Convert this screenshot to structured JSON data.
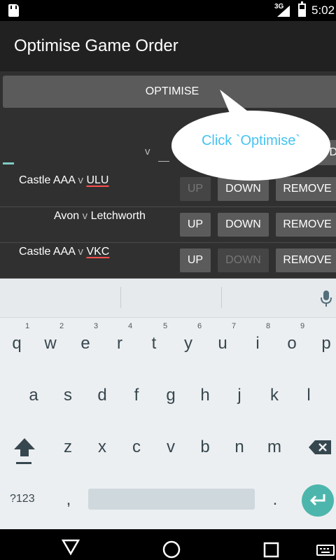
{
  "status_bar": {
    "network_label": "3G",
    "time": "5:02",
    "icons": [
      "sd-card-icon",
      "signal-icon",
      "battery-icon"
    ]
  },
  "app_bar": {
    "title": "Optimise Game Order"
  },
  "optimise_button": {
    "label": "OPTIMISE"
  },
  "input_row": {
    "separator": "v",
    "add_button_partial": "D"
  },
  "games": [
    {
      "home": "Castle AAA",
      "sep": "v",
      "away": "ULU",
      "up": "UP",
      "down": "DOWN",
      "remove": "REMOVE",
      "up_enabled": false,
      "down_enabled": true
    },
    {
      "home": "Avon",
      "sep": "v",
      "away": "Letchworth",
      "up": "UP",
      "down": "DOWN",
      "remove": "REMOVE",
      "up_enabled": true,
      "down_enabled": true
    },
    {
      "home": "Castle AAA",
      "sep": "v",
      "away": "VKC",
      "up": "UP",
      "down": "DOWN",
      "remove": "REMOVE",
      "up_enabled": true,
      "down_enabled": false
    }
  ],
  "tooltip": {
    "text": "Click `Optimise`"
  },
  "keyboard": {
    "row1": [
      "q",
      "w",
      "e",
      "r",
      "t",
      "y",
      "u",
      "i",
      "o",
      "p"
    ],
    "row1_hints": [
      "1",
      "2",
      "3",
      "4",
      "5",
      "6",
      "7",
      "8",
      "9"
    ],
    "row2": [
      "a",
      "s",
      "d",
      "f",
      "g",
      "h",
      "j",
      "k",
      "l"
    ],
    "row3": [
      "z",
      "x",
      "c",
      "v",
      "b",
      "n",
      "m"
    ],
    "symbols_key": "?123",
    "comma_key": ",",
    "period_key": ".",
    "icons": [
      "microphone-icon",
      "shift-icon",
      "backspace-icon",
      "enter-icon"
    ]
  },
  "nav_bar": {
    "icons": [
      "back-icon",
      "home-icon",
      "recents-icon",
      "keyboard-switch-icon"
    ]
  },
  "colors": {
    "accent": "#80cbc4",
    "tooltip_text": "#45c3f0",
    "enter_key": "#4db6ac",
    "spellcheck": "#ff4f4f"
  }
}
